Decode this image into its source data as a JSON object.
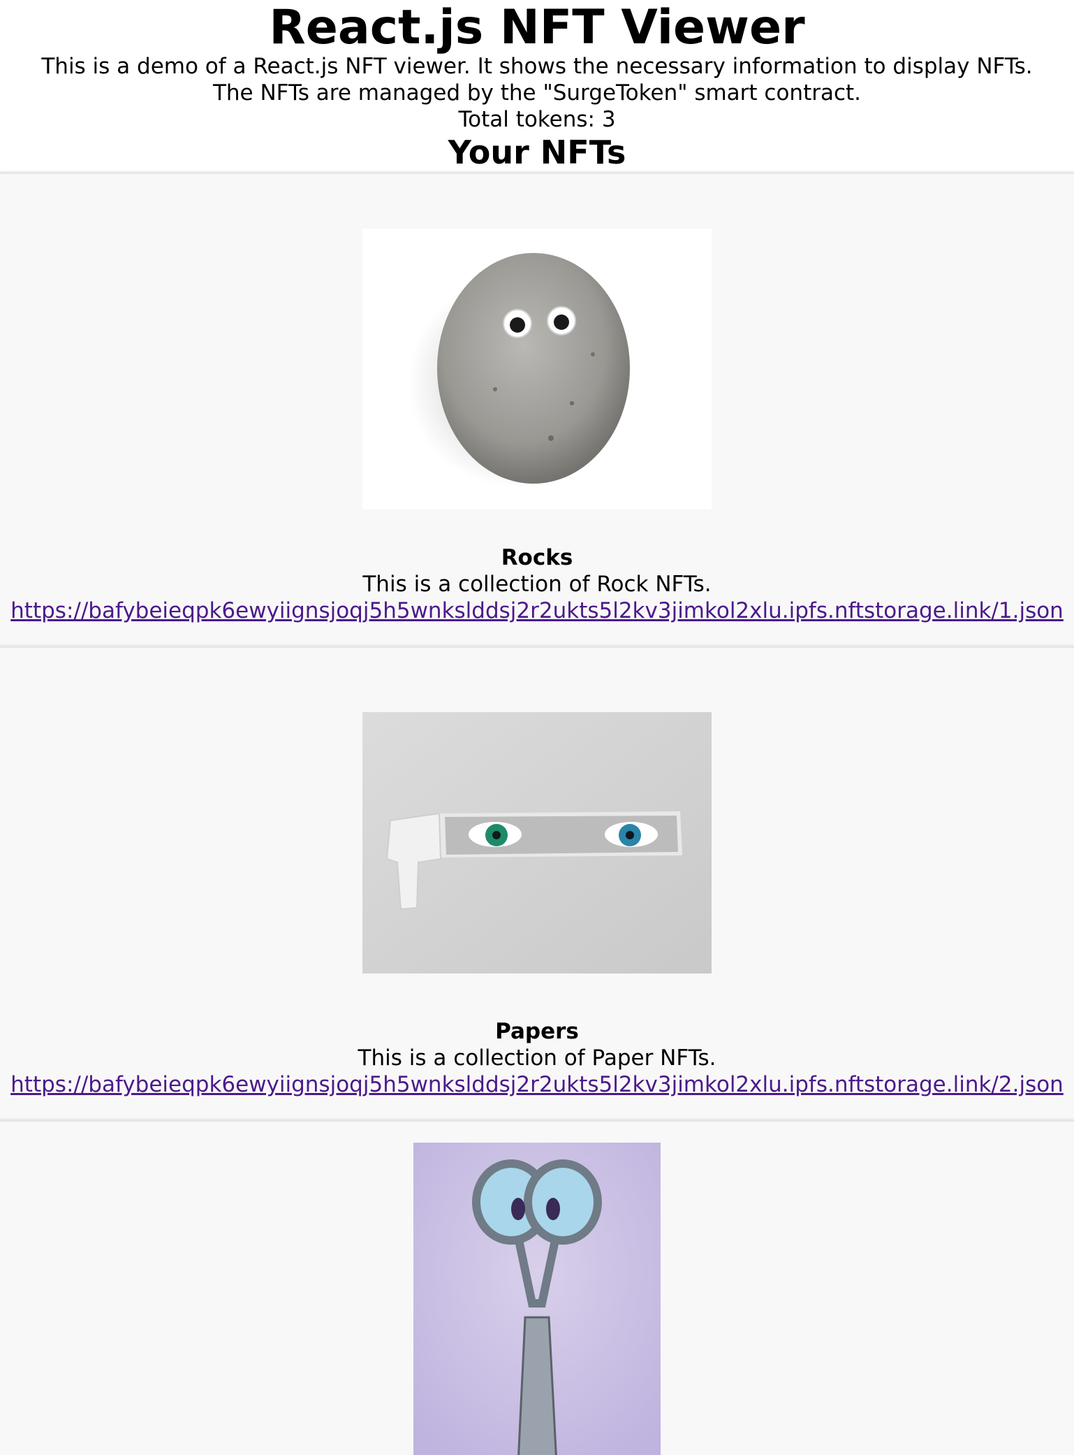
{
  "header": {
    "title": "React.js NFT Viewer",
    "description_1": "This is a demo of a React.js NFT viewer. It shows the necessary information to display NFTs.",
    "description_2": "The NFTs are managed by the \"SurgeToken\" smart contract.",
    "total_tokens": "Total tokens: 3",
    "section_title": "Your NFTs"
  },
  "nfts": [
    {
      "name": "Rocks",
      "description": "This is a collection of Rock NFTs.",
      "link": "https://bafybeieqpk6ewyiignsjoqj5h5wnkslddsj2r2ukts5l2kv3jimkol2xlu.ipfs.nftstorage.link/1.json",
      "image_icon": "rock-with-googly-eyes-image"
    },
    {
      "name": "Papers",
      "description": "This is a collection of Paper NFTs.",
      "link": "https://bafybeieqpk6ewyiignsjoqj5h5wnkslddsj2r2ukts5l2kv3jimkol2xlu.ipfs.nftstorage.link/2.json",
      "image_icon": "torn-paper-eyes-image"
    },
    {
      "image_icon": "scissors-with-eyes-image"
    }
  ],
  "colors": {
    "link": "#4b1a8a",
    "card_bg": "#f8f8f8"
  }
}
